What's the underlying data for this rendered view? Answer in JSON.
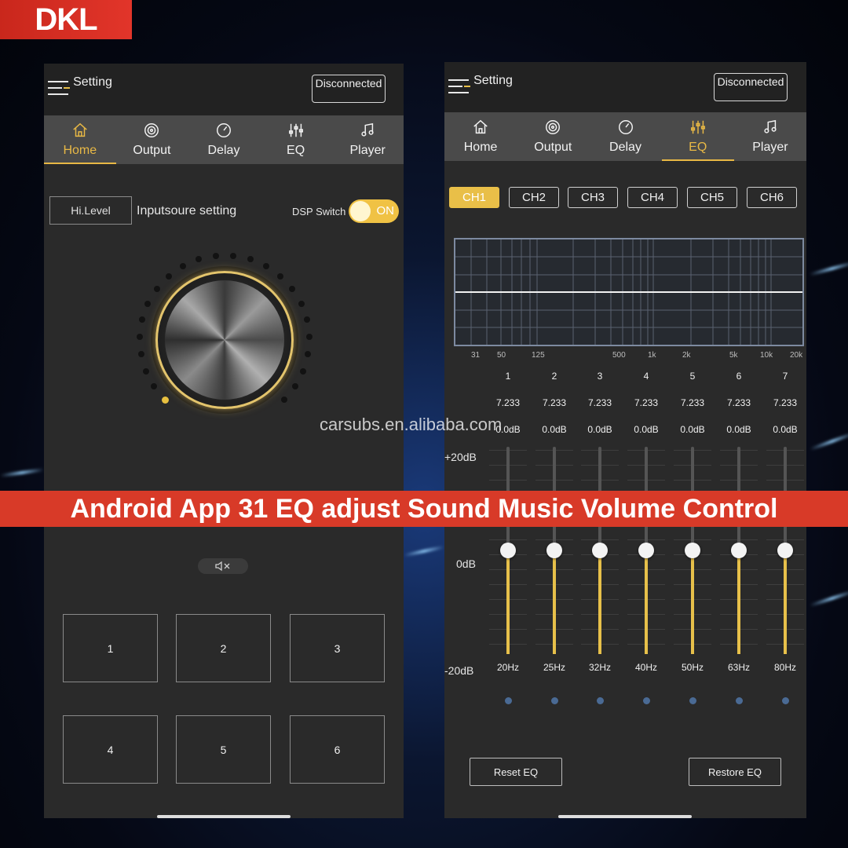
{
  "brand": {
    "logo_text": "DKL",
    "accent": "#e2352a"
  },
  "watermark": "carsubs.en.alibaba.com",
  "banner_text": "Android App 31 EQ adjust Sound Music Volume Control",
  "colors": {
    "active": "#e8b845",
    "panel": "#2a2a2a",
    "nav": "#4a4a4a",
    "slider_fill": "#e7c04a"
  },
  "left_screen": {
    "title": "Setting",
    "disconnect_label": "Disconnected",
    "tabs": [
      {
        "label": "Home",
        "icon": "home-icon",
        "active": true
      },
      {
        "label": "Output",
        "icon": "disc-icon",
        "active": false
      },
      {
        "label": "Delay",
        "icon": "clock-icon",
        "active": false
      },
      {
        "label": "EQ",
        "icon": "equalizer-icon",
        "active": false
      },
      {
        "label": "Player",
        "icon": "music-note-icon",
        "active": false
      }
    ],
    "input_level": "Hi.Level",
    "input_setting_label": "Inputsoure setting",
    "dsp_switch_label": "DSP Switch",
    "dsp_state": "ON",
    "volume_level": 0,
    "mute_icon": "mute-speaker-icon",
    "presets": [
      "1",
      "2",
      "3",
      "4",
      "5",
      "6"
    ]
  },
  "right_screen": {
    "title": "Setting",
    "disconnect_label": "Disconnected",
    "tabs": [
      {
        "label": "Home",
        "icon": "home-icon",
        "active": false
      },
      {
        "label": "Output",
        "icon": "disc-icon",
        "active": false
      },
      {
        "label": "Delay",
        "icon": "clock-icon",
        "active": false
      },
      {
        "label": "EQ",
        "icon": "equalizer-icon",
        "active": true
      },
      {
        "label": "Player",
        "icon": "music-note-icon",
        "active": false
      }
    ],
    "channels": [
      "CH1",
      "CH2",
      "CH3",
      "CH4",
      "CH5",
      "CH6"
    ],
    "active_channel": "CH1",
    "freq_scale": [
      "31",
      "50",
      "125",
      "500",
      "1k",
      "2k",
      "5k",
      "10k",
      "20k"
    ],
    "db_labels": {
      "top": "+20dB",
      "mid": "0dB",
      "bottom": "-20dB"
    },
    "bands": [
      {
        "num": "1",
        "q": "7.233",
        "gain": "0.0dB",
        "freq": "20Hz",
        "level_db": 0
      },
      {
        "num": "2",
        "q": "7.233",
        "gain": "0.0dB",
        "freq": "25Hz",
        "level_db": 0
      },
      {
        "num": "3",
        "q": "7.233",
        "gain": "0.0dB",
        "freq": "32Hz",
        "level_db": 0
      },
      {
        "num": "4",
        "q": "7.233",
        "gain": "0.0dB",
        "freq": "40Hz",
        "level_db": 0
      },
      {
        "num": "5",
        "q": "7.233",
        "gain": "0.0dB",
        "freq": "50Hz",
        "level_db": 0
      },
      {
        "num": "6",
        "q": "7.233",
        "gain": "0.0dB",
        "freq": "63Hz",
        "level_db": 0
      },
      {
        "num": "7",
        "q": "7.233",
        "gain": "0.0dB",
        "freq": "80Hz",
        "level_db": 0
      }
    ],
    "reset_label": "Reset EQ",
    "restore_label": "Restore EQ"
  }
}
